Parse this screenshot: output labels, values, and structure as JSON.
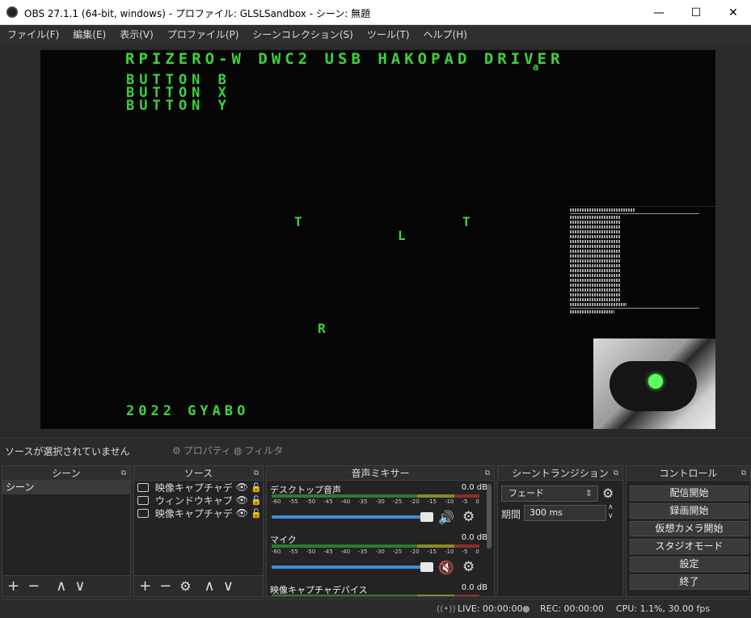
{
  "window": {
    "title": "OBS 27.1.1 (64-bit, windows) - プロファイル: GLSLSandbox - シーン: 無題",
    "minimize": "—",
    "maximize": "☐",
    "close": "✕"
  },
  "menu": [
    "ファイル(F)",
    "編集(E)",
    "表示(V)",
    "プロファイル(P)",
    "シーンコレクション(S)",
    "ツール(T)",
    "ヘルプ(H)"
  ],
  "preview": {
    "header": "RPIZERO-W DWC2 USB HAKOPAD DRIVER",
    "buttons": [
      "BUTTON B",
      "BUTTON X",
      "BUTTON Y"
    ],
    "letters": {
      "t1": "T",
      "l": "L",
      "t2": "T",
      "r": "R"
    },
    "footer": "2022 GYABO"
  },
  "status": {
    "no_source": "ソースが選択されていません",
    "properties": "プロパティ",
    "filters": "フィルタ"
  },
  "scenes": {
    "header": "シーン",
    "items": [
      "シーン"
    ]
  },
  "sources": {
    "header": "ソース",
    "items": [
      "映像キャプチャデバ",
      "ウィンドウキャプチャ",
      "映像キャプチャデバ"
    ]
  },
  "mixer": {
    "header": "音声ミキサー",
    "ticks": [
      "-60",
      "-55",
      "-50",
      "-45",
      "-40",
      "-35",
      "-30",
      "-25",
      "-20",
      "-15",
      "-10",
      "-5",
      "0"
    ],
    "channels": [
      {
        "name": "デスクトップ音声",
        "db": "0.0 dB",
        "muted": false
      },
      {
        "name": "マイク",
        "db": "0.0 dB",
        "muted": true
      },
      {
        "name": "映像キャプチャデバイス",
        "db": "0.0 dB",
        "muted": false
      }
    ]
  },
  "transitions": {
    "header": "シーントランジション",
    "selected": "フェード",
    "duration_label": "期間",
    "duration": "300 ms"
  },
  "controls": {
    "header": "コントロール",
    "buttons": [
      "配信開始",
      "録画開始",
      "仮想カメラ開始",
      "スタジオモード",
      "設定",
      "終了"
    ]
  },
  "bottom": {
    "live": "LIVE: 00:00:00",
    "rec": "REC: 00:00:00",
    "cpu": "CPU: 1.1%, 30.00 fps"
  },
  "colors": {
    "accent": "#3b8fd8",
    "preview_text": "#3dd33d",
    "mute": "#e03030"
  }
}
